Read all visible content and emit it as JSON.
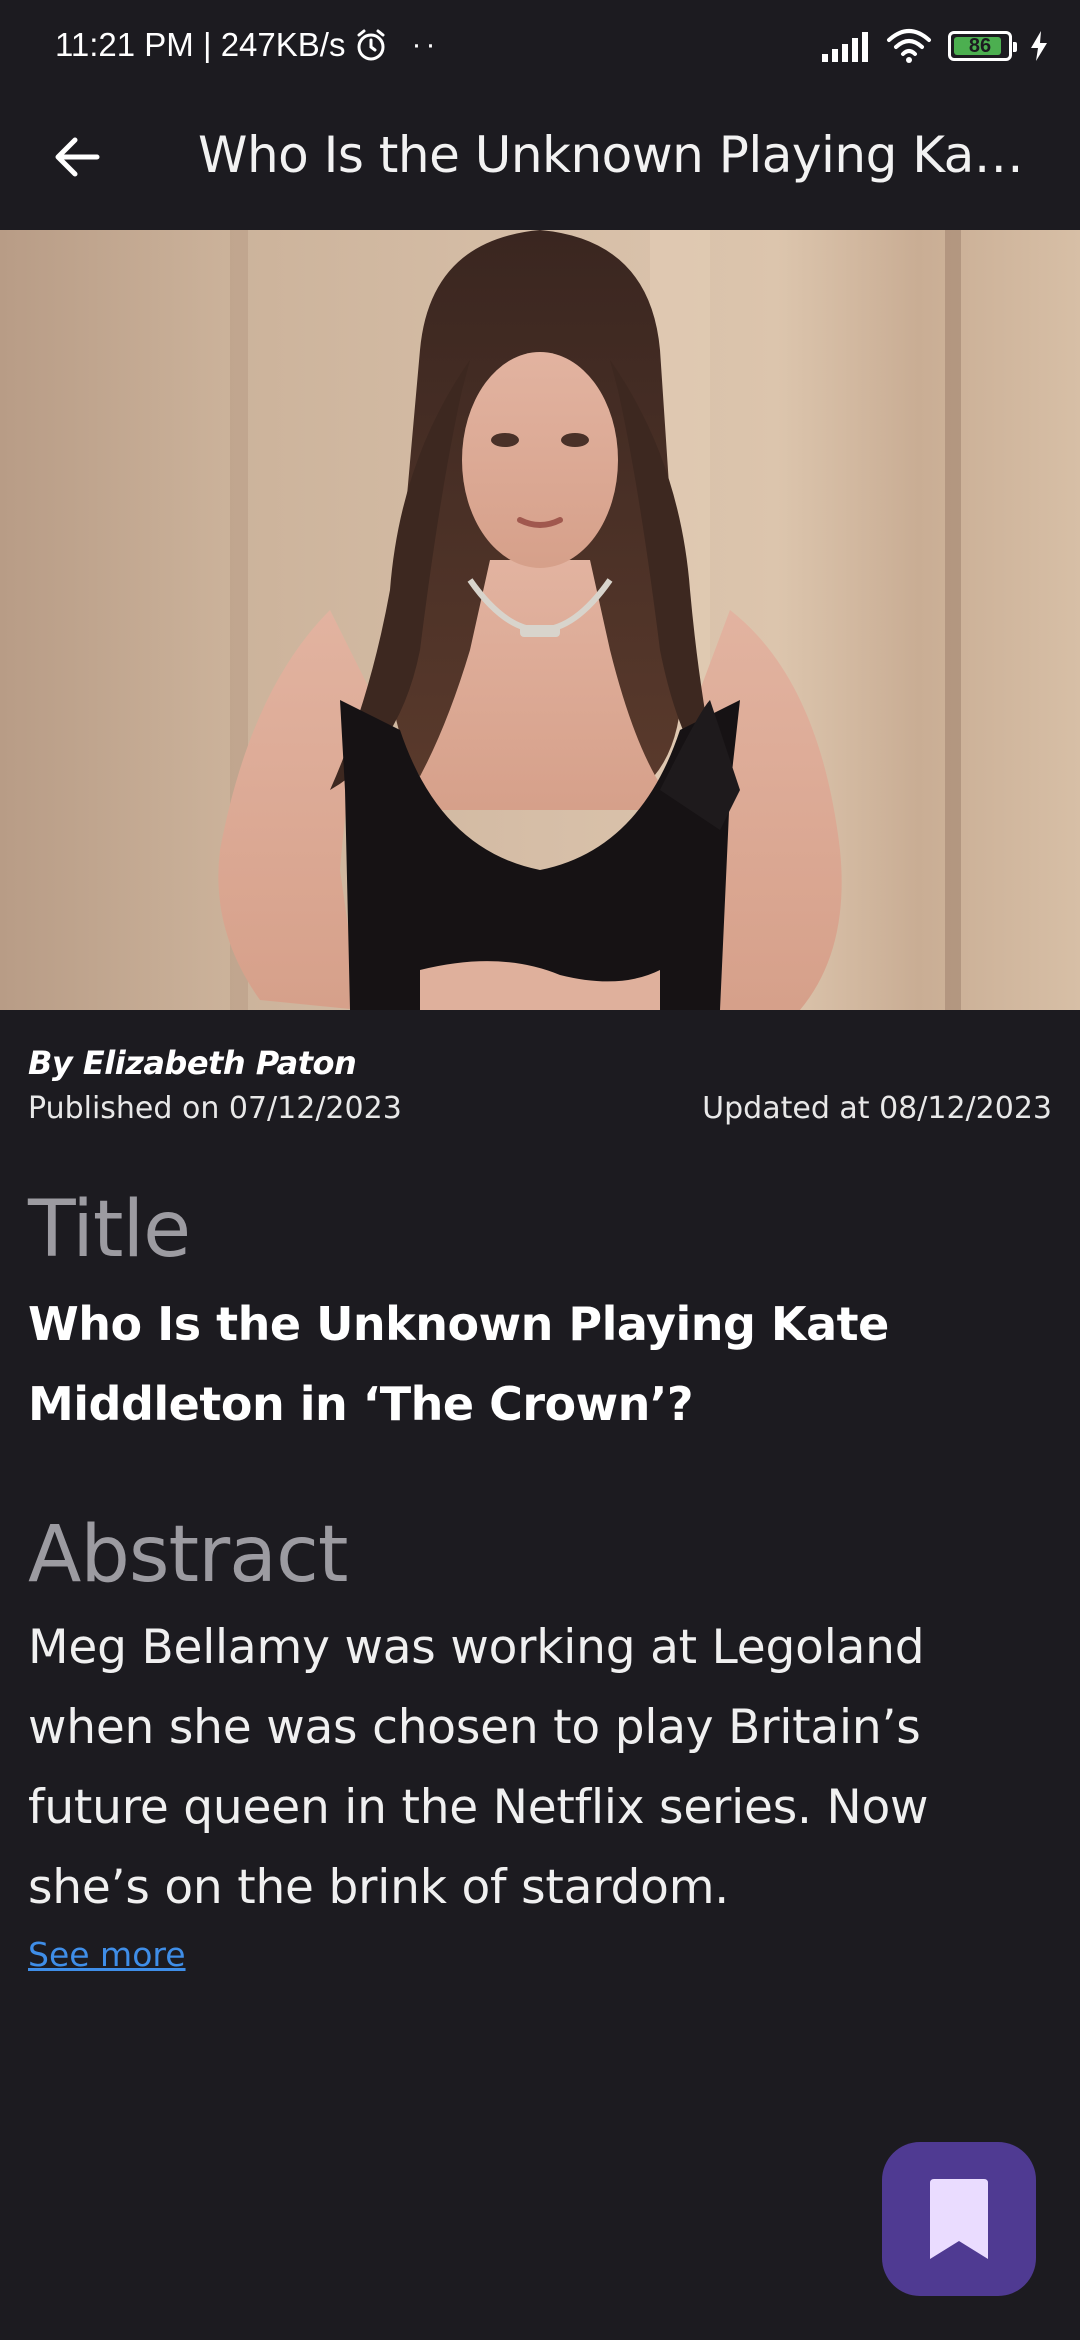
{
  "status_bar": {
    "time_speed": "11:21 PM | 247KB/s",
    "dots": "··",
    "battery_level": "86",
    "battery_fraction": 0.86,
    "icons": [
      "alarm-icon",
      "signal-icon",
      "wifi-icon",
      "battery-icon",
      "charging-icon"
    ]
  },
  "app_bar": {
    "title": "Who Is the Unknown Playing Kate Middleton in ‘The Crown’?",
    "back_icon": "arrow-back-icon"
  },
  "article": {
    "author": "By Elizabeth Paton",
    "published": "Published on 07/12/2023",
    "updated": "Updated at 08/12/2023",
    "title_label": "Title",
    "title": "Who Is the Unknown Playing Kate Middleton in ‘The Crown’?",
    "abstract_label": "Abstract",
    "abstract": "Meg Bellamy was working at Legoland when she was chosen to play Britain’s future queen in the Netflix series. Now she’s on the brink of stardom.",
    "see_more": "See more"
  },
  "fab": {
    "icon": "bookmark-icon"
  },
  "colors": {
    "background": "#1c1b20",
    "label_gray": "#9c9ba1",
    "link_blue": "#3f8ee8",
    "fab_purple": "#4f3a92",
    "fab_icon": "#eadcff"
  }
}
